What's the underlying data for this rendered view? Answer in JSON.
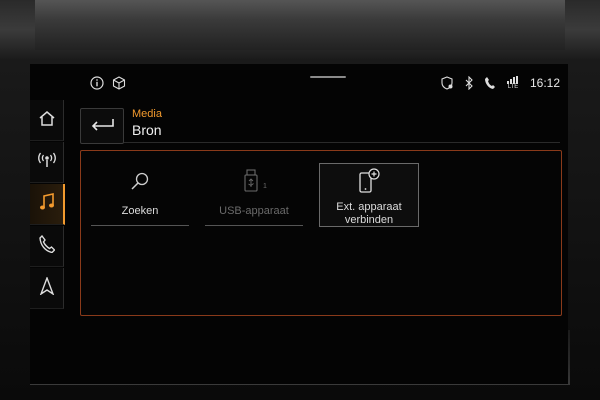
{
  "status_bar": {
    "time": "16:12",
    "icons": [
      "info-icon",
      "car-icon",
      "location-shield-icon",
      "bluetooth-icon",
      "phone-icon",
      "lte-signal-icon"
    ],
    "lte_label": "LTE"
  },
  "nav": {
    "items": [
      {
        "icon": "home-icon"
      },
      {
        "icon": "radio-icon"
      },
      {
        "icon": "music-note-icon",
        "active": true
      },
      {
        "icon": "phone-icon"
      },
      {
        "icon": "navigation-icon"
      }
    ]
  },
  "header": {
    "subtitle": "Media",
    "title": "Bron"
  },
  "tiles": [
    {
      "label": "Zoeken",
      "icon": "search-icon"
    },
    {
      "label": "USB-apparaat",
      "icon": "usb-icon",
      "disabled": true,
      "badge": "1"
    },
    {
      "label": "Ext. apparaat verbinden",
      "icon": "add-device-icon"
    }
  ],
  "colors": {
    "accent": "#f29a2e",
    "panel_border": "#8a3a1a",
    "background": "#040404"
  }
}
